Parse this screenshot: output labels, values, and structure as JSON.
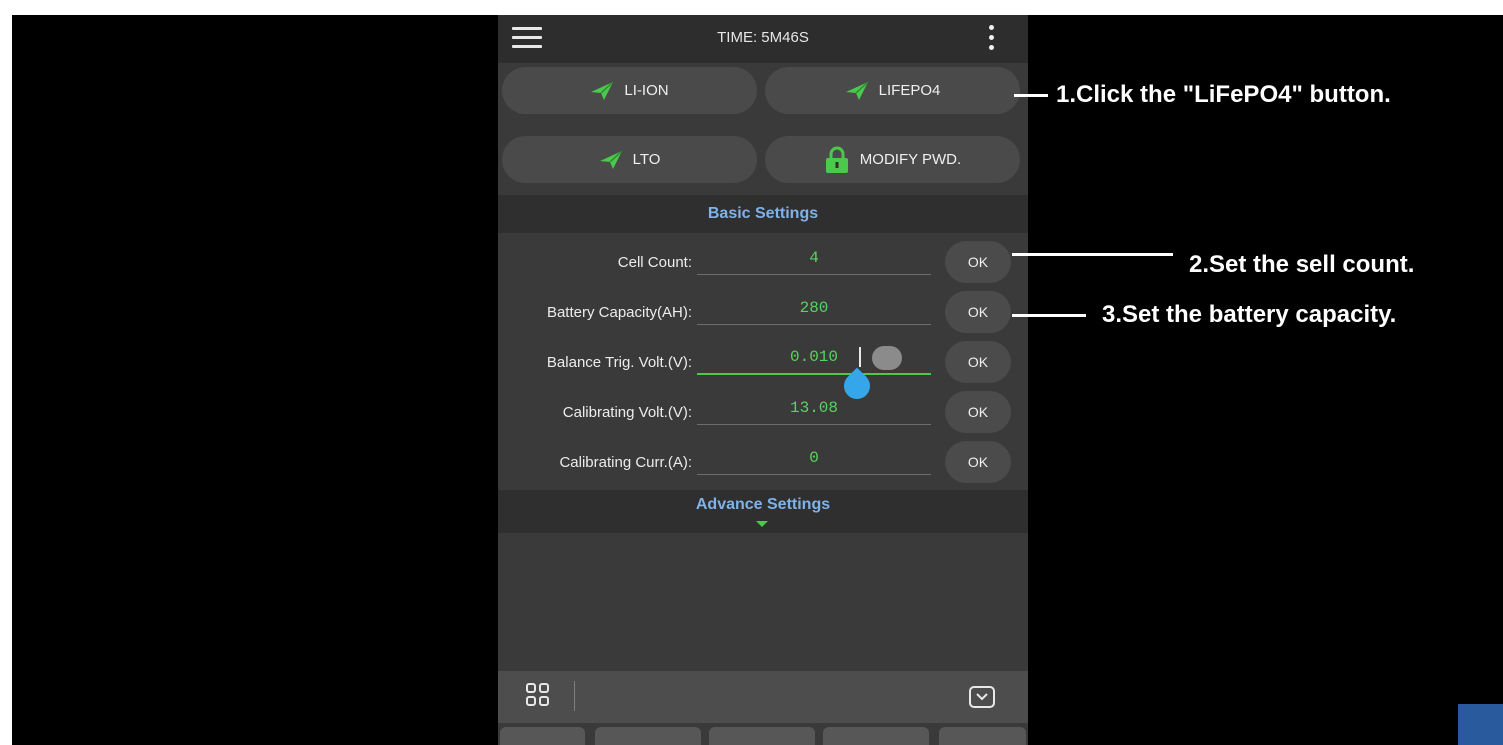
{
  "header": {
    "time_label": "TIME: 5M46S",
    "menu_icon": "hamburger-menu-icon",
    "more_icon": "vertical-dots-icon"
  },
  "chemistry_buttons": [
    {
      "label": "LI-ION",
      "icon": "paper-plane-icon"
    },
    {
      "label": "LIFEPO4",
      "icon": "paper-plane-icon"
    },
    {
      "label": "LTO",
      "icon": "paper-plane-icon"
    },
    {
      "label": "MODIFY PWD.",
      "icon": "lock-icon"
    }
  ],
  "basic_settings": {
    "title": "Basic Settings",
    "rows": [
      {
        "label": "Cell Count:",
        "value": "4",
        "ok": "OK"
      },
      {
        "label": "Battery Capacity(AH):",
        "value": "280",
        "ok": "OK"
      },
      {
        "label": "Balance Trig. Volt.(V):",
        "value": "0.010",
        "ok": "OK"
      },
      {
        "label": "Calibrating Volt.(V):",
        "value": "13.08",
        "ok": "OK"
      },
      {
        "label": "Calibrating Curr.(A):",
        "value": "0",
        "ok": "OK"
      }
    ]
  },
  "advance_settings": {
    "title": "Advance Settings"
  },
  "annotations": [
    {
      "text": "1.Click the \"LiFePO4\" button."
    },
    {
      "text": "2.Set the sell count."
    },
    {
      "text": "3.Set the battery capacity."
    }
  ],
  "colors": {
    "accent_green": "#4cc94c",
    "value_green": "#59d35f",
    "header_blue": "#7fb2e8",
    "handle_blue": "#35a6ea"
  }
}
